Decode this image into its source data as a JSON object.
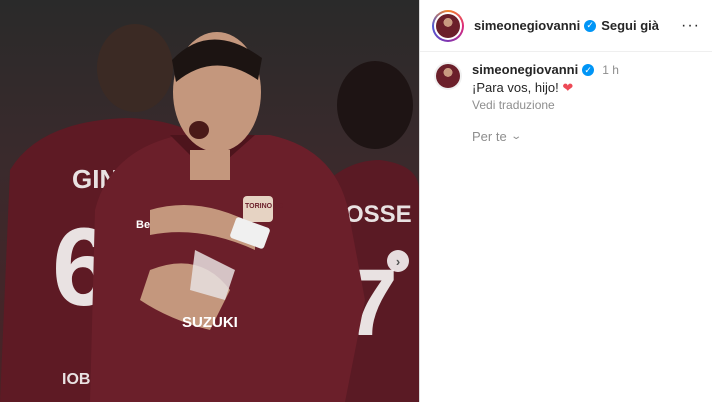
{
  "post": {
    "username": "simeonegiovanni",
    "follow_label": "Segui già",
    "more_glyph": "···",
    "verified_glyph": "✓"
  },
  "caption": {
    "username": "simeonegiovanni",
    "time": "1 h",
    "text": "¡Para vos, hijo!",
    "heart_glyph": "❤",
    "translate_label": "Vedi traduzione",
    "for_you_label": "Per te",
    "chevron_glyph": "⌄"
  },
  "media": {
    "next_glyph": "›",
    "jersey_text_center": "SUZUKI",
    "jersey_badge": "TORINO FC",
    "jersey_sponsor_left": "Beko Scores",
    "back_name_left": "GINEB",
    "back_number_left": "6",
    "back_name_right": "OSSE",
    "back_number_right": "7",
    "shorts_sponsor": "IOBATM"
  },
  "colors": {
    "jersey": "#6b1f2a",
    "verified": "#0095f6",
    "heart": "#ed4956",
    "muted_text": "#8e8e8e"
  }
}
